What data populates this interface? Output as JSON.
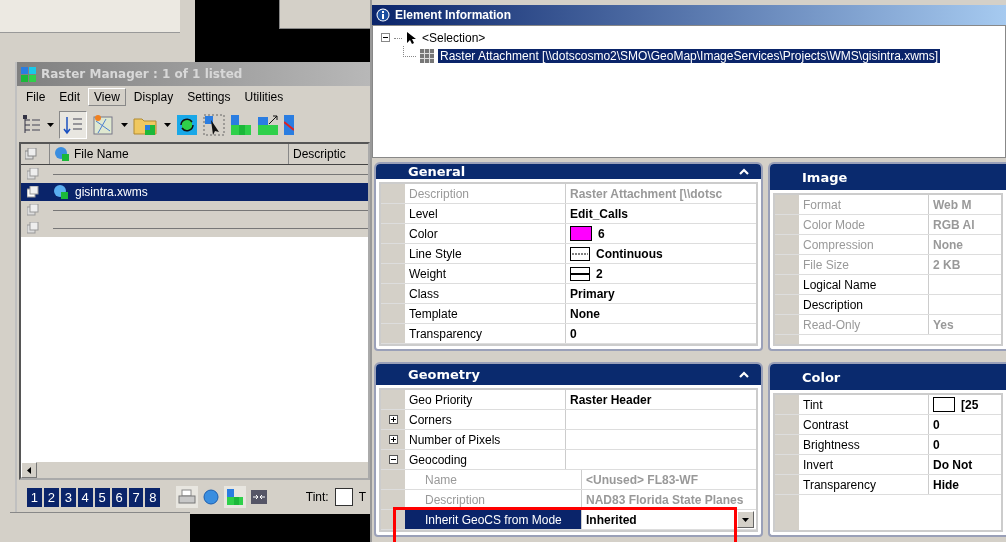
{
  "raster_manager": {
    "title": "Raster Manager : 1 of 1 listed",
    "menu": [
      {
        "label": "File",
        "selected": false
      },
      {
        "label": "Edit",
        "selected": false
      },
      {
        "label": "View",
        "selected": true
      },
      {
        "label": "Display",
        "selected": false
      },
      {
        "label": "Settings",
        "selected": false
      },
      {
        "label": "Utilities",
        "selected": false
      }
    ],
    "columns": [
      "File Name",
      "Descriptic"
    ],
    "rows": [
      {
        "selected": false
      },
      {
        "file_name": "gisintra.xwms",
        "selected": true
      },
      {
        "selected": false
      },
      {
        "selected": false
      }
    ],
    "view_buttons": [
      "1",
      "2",
      "3",
      "4",
      "5",
      "6",
      "7",
      "8"
    ],
    "toggles": [
      {
        "kind": "printer",
        "selected": true
      },
      {
        "kind": "globe",
        "selected": false
      },
      {
        "kind": "raster",
        "selected": true
      },
      {
        "kind": "arrows",
        "selected": false
      }
    ],
    "tint_label": "Tint:",
    "column_3": "T"
  },
  "element_information": {
    "title": "Element Information",
    "tree": {
      "label": "<Selection>",
      "expanded": true,
      "children": [
        {
          "label": "Raster Attachment [\\\\dotscosmo2\\SMO\\GeoMap\\ImageServices\\Projects\\WMS\\gisintra.xwms]",
          "selected": true
        }
      ]
    },
    "sections": [
      {
        "title": "General",
        "expanded": true,
        "rows": [
          {
            "label": "Description",
            "value": "Raster Attachment [\\\\dotsc",
            "disabled": true
          },
          {
            "label": "Level",
            "value": "Edit_Calls",
            "disabled": false
          },
          {
            "label": "Color",
            "value": "6",
            "kind": "color",
            "color": "#ff00ff",
            "disabled": false
          },
          {
            "label": "Line Style",
            "value": "Continuous",
            "kind": "line-style",
            "disabled": false
          },
          {
            "label": "Weight",
            "value": "2",
            "kind": "weight",
            "disabled": false
          },
          {
            "label": "Class",
            "value": "Primary",
            "disabled": false
          },
          {
            "label": "Template",
            "value": "None",
            "disabled": false
          },
          {
            "label": "Transparency",
            "value": "0",
            "disabled": false
          }
        ]
      },
      {
        "title": "Image",
        "rows": [
          {
            "label": "Format",
            "value": "Web M",
            "disabled": true
          },
          {
            "label": "Color Mode",
            "value": "RGB Al",
            "disabled": true
          },
          {
            "label": "Compression",
            "value": "None",
            "disabled": true
          },
          {
            "label": "File Size",
            "value": "2 KB",
            "disabled": true
          },
          {
            "label": "Logical Name",
            "disabled": false
          },
          {
            "label": "Description",
            "disabled": false
          },
          {
            "label": "Read-Only",
            "value": "Yes",
            "disabled": true
          }
        ]
      },
      {
        "title": "Geometry",
        "expanded": true,
        "rows": [
          {
            "label": "Geo Priority",
            "value": "Raster Header",
            "disabled": false
          },
          {
            "label": "Corners",
            "expanded": false,
            "disabled": false
          },
          {
            "label": "Number of Pixels",
            "expanded": false,
            "disabled": false
          },
          {
            "label": "Geocoding",
            "expanded": true,
            "disabled": false,
            "children": [
              {
                "label": "Name",
                "value": "<Unused> FL83-WF",
                "disabled": true
              },
              {
                "label": "Description",
                "value": "NAD83 Florida State Planes",
                "disabled": true
              },
              {
                "label": "Inherit GeoCS from Mode",
                "value": "Inherited",
                "kind": "dropdown",
                "disabled": false,
                "selected": true
              }
            ]
          }
        ]
      },
      {
        "title": "Color",
        "rows": [
          {
            "label": "Tint",
            "value": "[25",
            "kind": "color",
            "color": "#ffffff",
            "disabled": false
          },
          {
            "label": "Contrast",
            "value": "0",
            "disabled": false
          },
          {
            "label": "Brightness",
            "value": "0",
            "disabled": false
          },
          {
            "label": "Invert",
            "value": "Do Not",
            "disabled": false
          },
          {
            "label": "Transparency",
            "value": "Hide",
            "disabled": false
          }
        ]
      }
    ]
  }
}
